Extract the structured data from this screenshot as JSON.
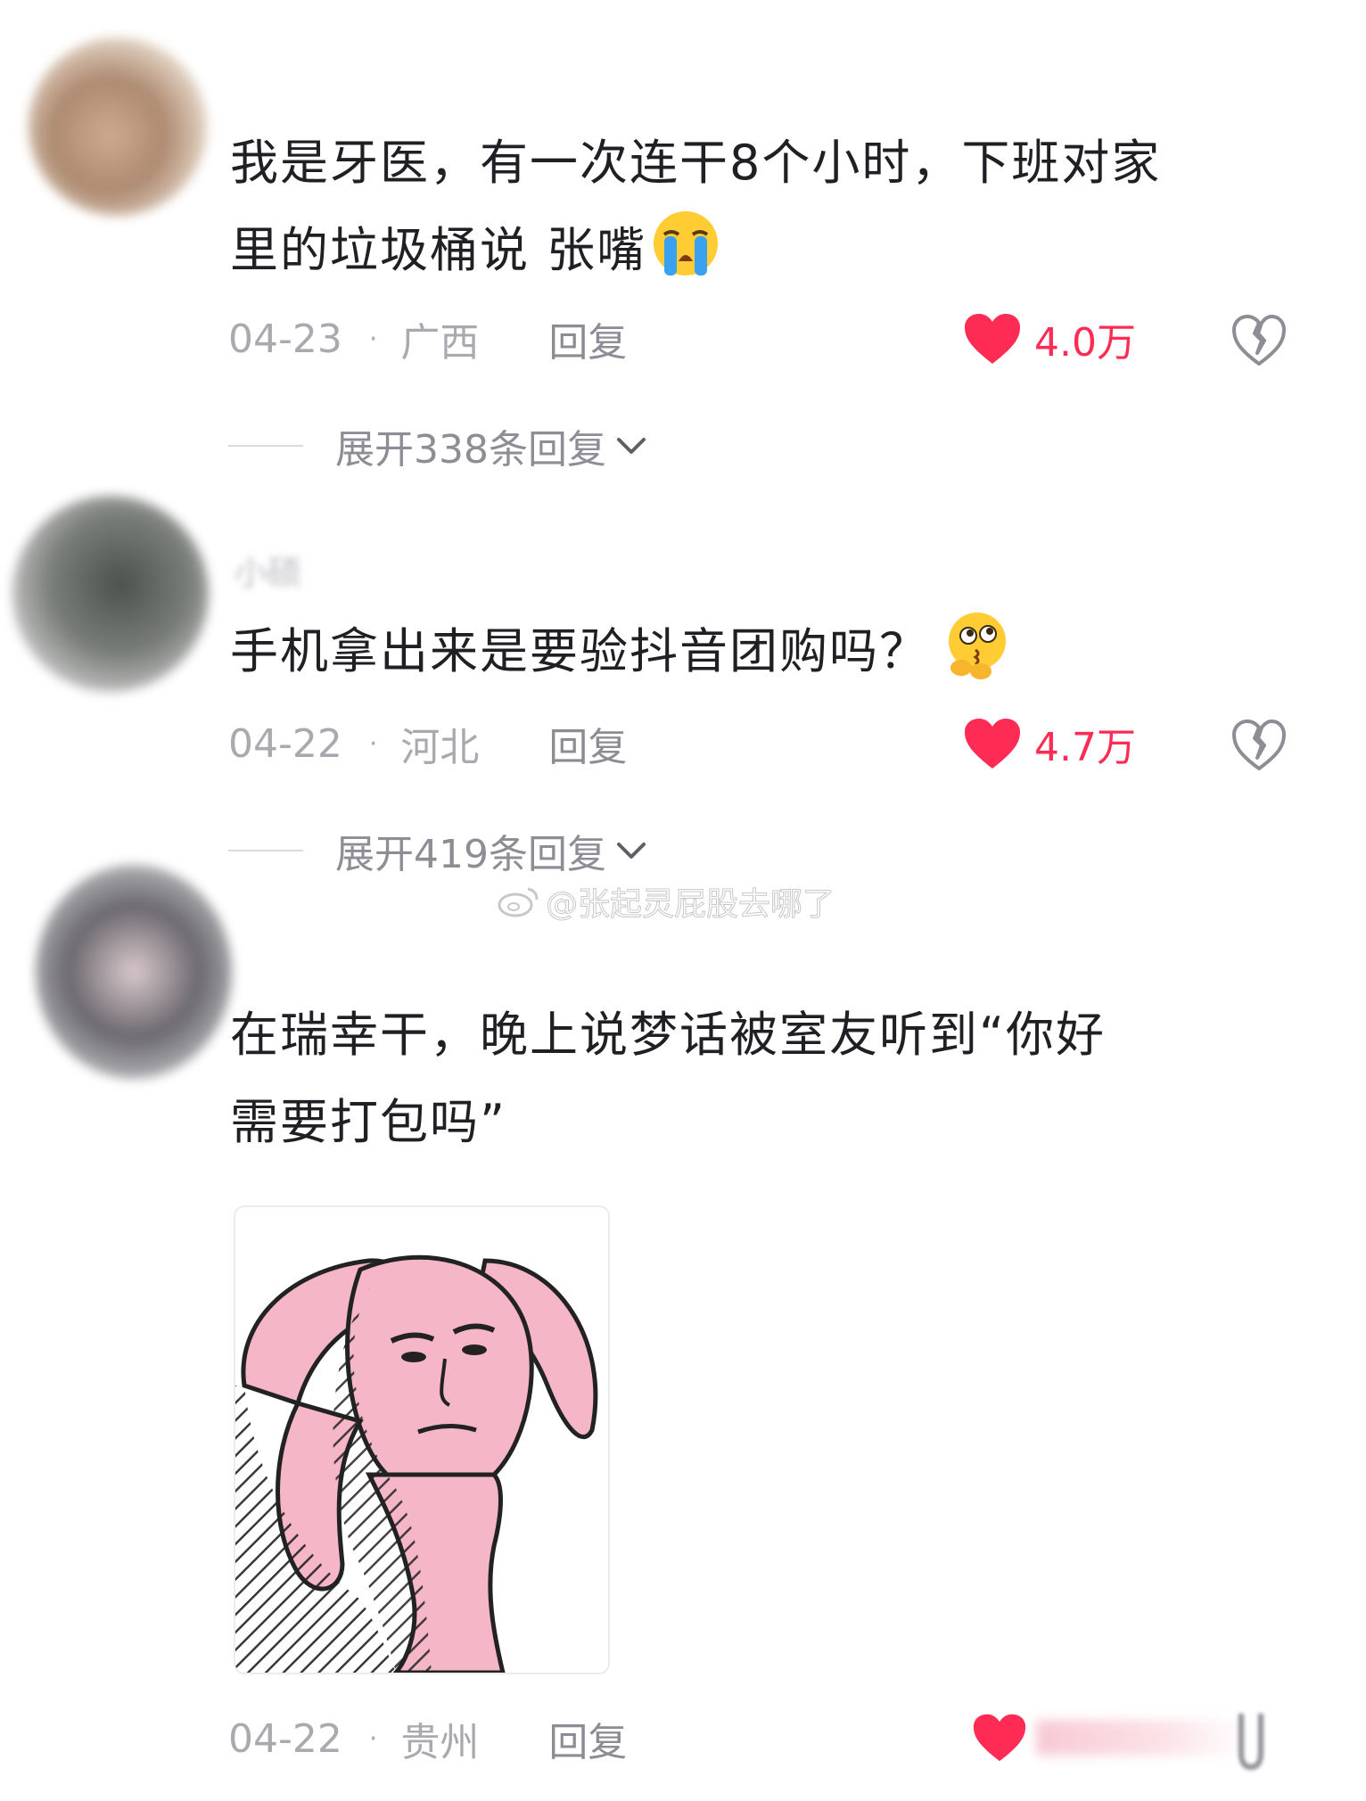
{
  "comments": [
    {
      "username": "",
      "text_lines": [
        "我是牙医，有一次连干8个小时，下班对家",
        "里的垃圾桶说 张嘴"
      ],
      "emoji": "loudly-crying-face",
      "date": "04-23",
      "dot": "·",
      "location": "广西",
      "reply_label": "回复",
      "likes": "4.0万",
      "expand_label": "展开338条回复"
    },
    {
      "username": "小硕",
      "text_lines": [
        "手机拿出来是要验抖音团购吗？"
      ],
      "emoji": "thinking-blowing-kiss-face",
      "date": "04-22",
      "dot": "·",
      "location": "河北",
      "reply_label": "回复",
      "likes": "4.7万",
      "expand_label": "展开419条回复"
    },
    {
      "username": "",
      "text_lines": [
        "在瑞幸干，晚上说梦话被室友听到“你好",
        "需要打包吗”"
      ],
      "sticker": "pink-bunny-man-face-sticker",
      "date": "04-22",
      "dot": "·",
      "location": "贵州",
      "reply_label": "回复"
    }
  ],
  "watermark": {
    "text": "@张起灵屁股去哪了",
    "icon": "weibo-icon"
  },
  "colors": {
    "like_red": "#fe2c55",
    "meta_gray": "#a9a9b0",
    "text_dark": "#1f1f24"
  }
}
